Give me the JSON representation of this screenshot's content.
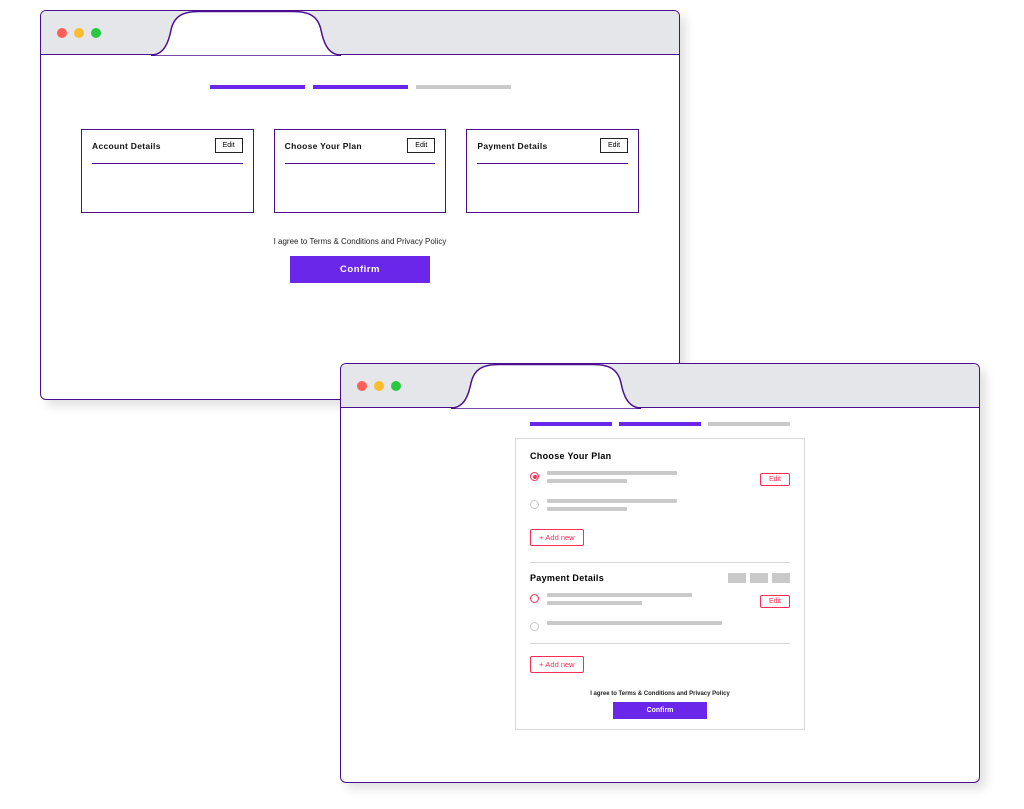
{
  "window1": {
    "progress_completed": 2,
    "cards": [
      {
        "title": "Account Details",
        "edit": "Edit"
      },
      {
        "title": "Choose Your Plan",
        "edit": "Edit"
      },
      {
        "title": "Payment Details",
        "edit": "Edit"
      }
    ],
    "agree": "I agree to Terms & Conditions and Privacy Policy",
    "confirm": "Confirm"
  },
  "window2": {
    "progress_completed": 2,
    "plan": {
      "title": "Choose Your Plan",
      "edit": "Edit",
      "add_new": "Add new"
    },
    "payment": {
      "title": "Payment Details",
      "edit": "Edit",
      "add_new": "Add new"
    },
    "agree": "I agree to Terms & Conditions and Privacy Policy",
    "confirm": "Confirm"
  }
}
